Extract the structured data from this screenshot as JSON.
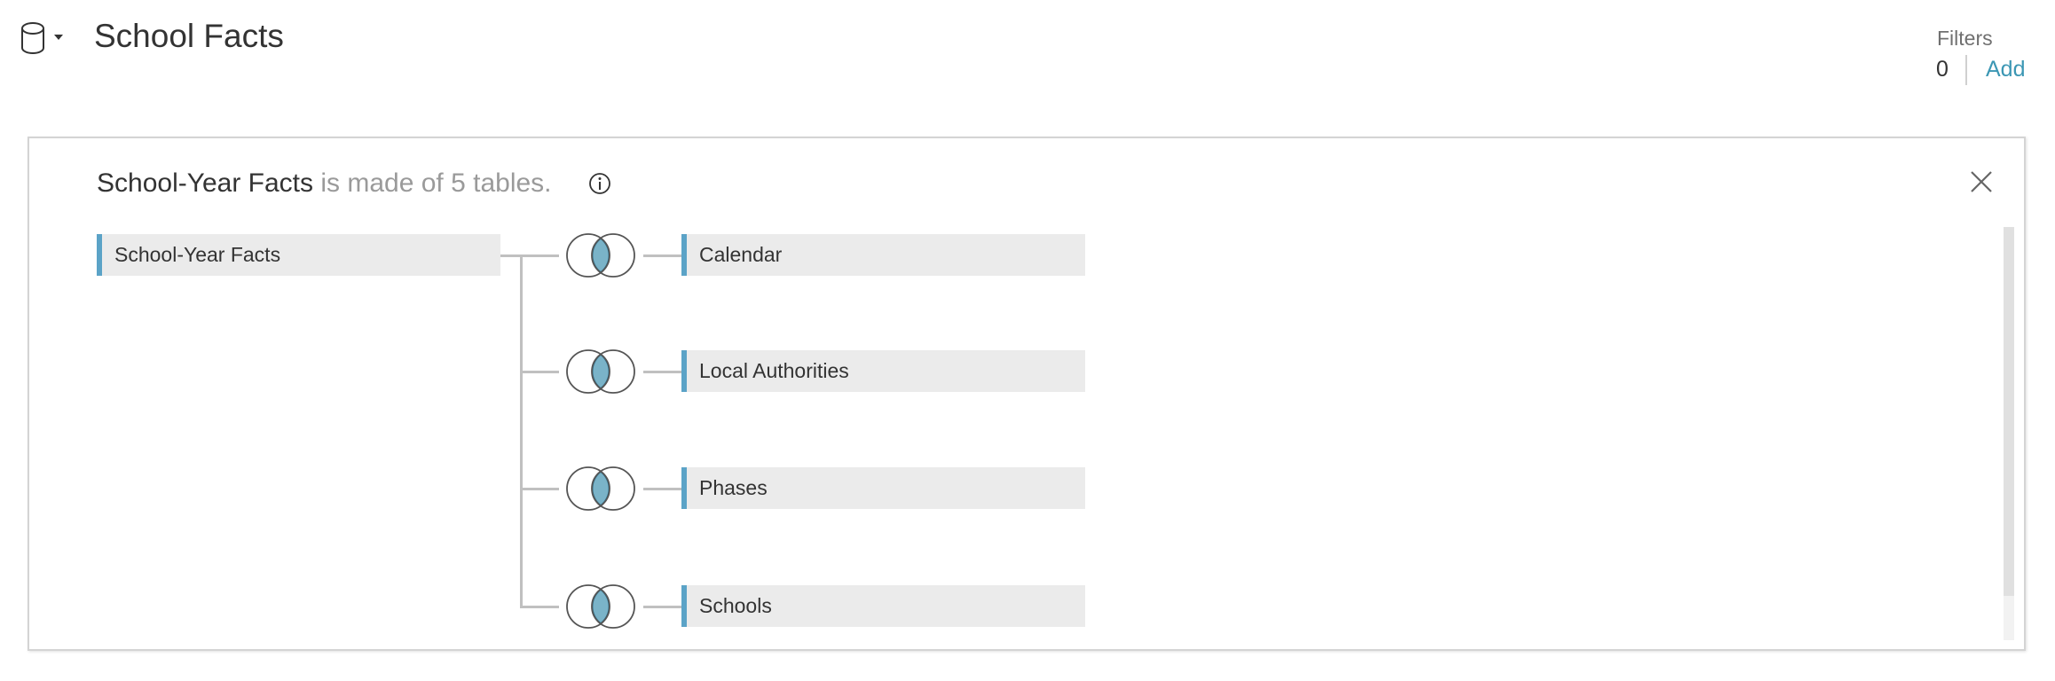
{
  "header": {
    "title": "School Facts",
    "datasource_icon": "database-icon",
    "dropdown_icon": "caret-down-icon"
  },
  "filters": {
    "label": "Filters",
    "count": "0",
    "add_label": "Add"
  },
  "panel": {
    "heading_table": "School-Year Facts",
    "heading_suffix": "is made of 5 tables.",
    "info_icon": "info-icon",
    "close_icon": "close-icon",
    "root_table": "School-Year Facts",
    "related_tables": [
      "Calendar",
      "Local Authorities",
      "Phases",
      "Schools"
    ],
    "join_type": "inner-join",
    "colors": {
      "accent": "#5ba3c7",
      "join_fill": "#7ab3c8",
      "link": "#3c97b4"
    }
  }
}
